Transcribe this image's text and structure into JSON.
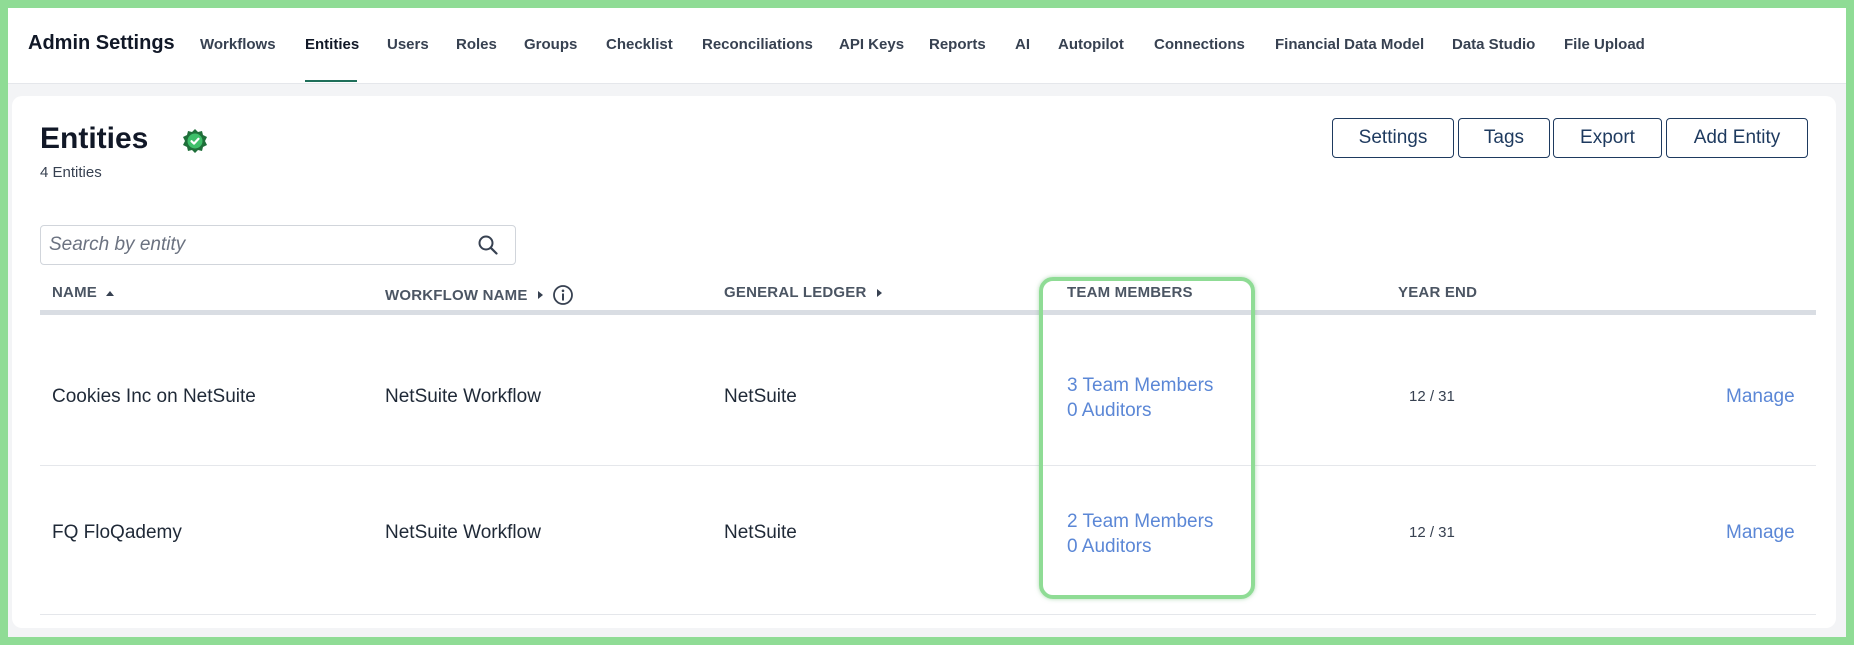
{
  "app": {
    "title": "Admin Settings"
  },
  "nav": {
    "tabs": [
      {
        "label": "Workflows"
      },
      {
        "label": "Entities",
        "active": true
      },
      {
        "label": "Users"
      },
      {
        "label": "Roles"
      },
      {
        "label": "Groups"
      },
      {
        "label": "Checklist"
      },
      {
        "label": "Reconciliations"
      },
      {
        "label": "API Keys"
      },
      {
        "label": "Reports"
      },
      {
        "label": "AI"
      },
      {
        "label": "Autopilot"
      },
      {
        "label": "Connections"
      },
      {
        "label": "Financial Data Model"
      },
      {
        "label": "Data Studio"
      },
      {
        "label": "File Upload"
      }
    ]
  },
  "page": {
    "title": "Entities",
    "count": "4 Entities",
    "status_icon": "check-badge-icon"
  },
  "toolbar": {
    "settings_label": "Settings",
    "tags_label": "Tags",
    "export_label": "Export",
    "add_label": "Add Entity"
  },
  "search": {
    "placeholder": "Search by entity"
  },
  "table": {
    "headers": {
      "name": "NAME",
      "workflow": "WORKFLOW NAME",
      "ledger": "GENERAL LEDGER",
      "team": "TEAM MEMBERS",
      "year_end": "YEAR END"
    },
    "rows": [
      {
        "name": "Cookies Inc on NetSuite",
        "workflow": "NetSuite Workflow",
        "ledger": "NetSuite",
        "team_members": "3 Team Members",
        "auditors": "0 Auditors",
        "year_end": "12 / 31",
        "action": "Manage"
      },
      {
        "name": "FQ FloQademy",
        "workflow": "NetSuite Workflow",
        "ledger": "NetSuite",
        "team_members": "2 Team Members",
        "auditors": "0 Auditors",
        "year_end": "12 / 31",
        "action": "Manage"
      }
    ]
  },
  "colors": {
    "accent": "#1e3a5f",
    "link": "#5b87d6",
    "highlight": "#8fdc95",
    "badge": "#1f6f3a"
  }
}
